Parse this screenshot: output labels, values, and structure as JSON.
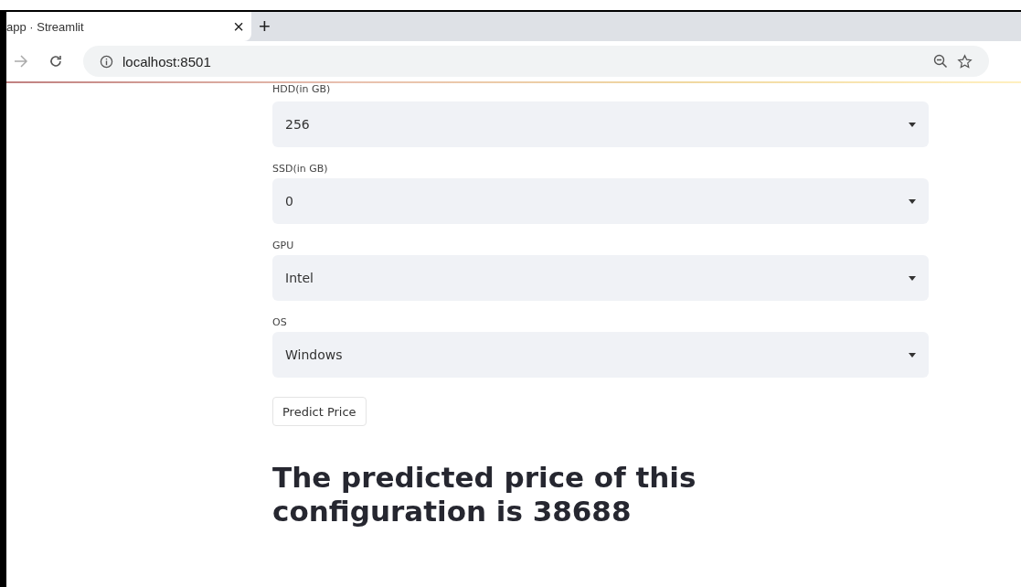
{
  "browser": {
    "tab": {
      "title": "app · Streamlit",
      "close": "×"
    },
    "new_tab": "+",
    "address": "localhost:8501"
  },
  "fields": [
    {
      "label": "HDD(in GB)",
      "value": "256"
    },
    {
      "label": "SSD(in GB)",
      "value": "0"
    },
    {
      "label": "GPU",
      "value": "Intel"
    },
    {
      "label": "OS",
      "value": "Windows"
    }
  ],
  "button": "Predict Price",
  "result": "The predicted price of this configuration is 38688"
}
